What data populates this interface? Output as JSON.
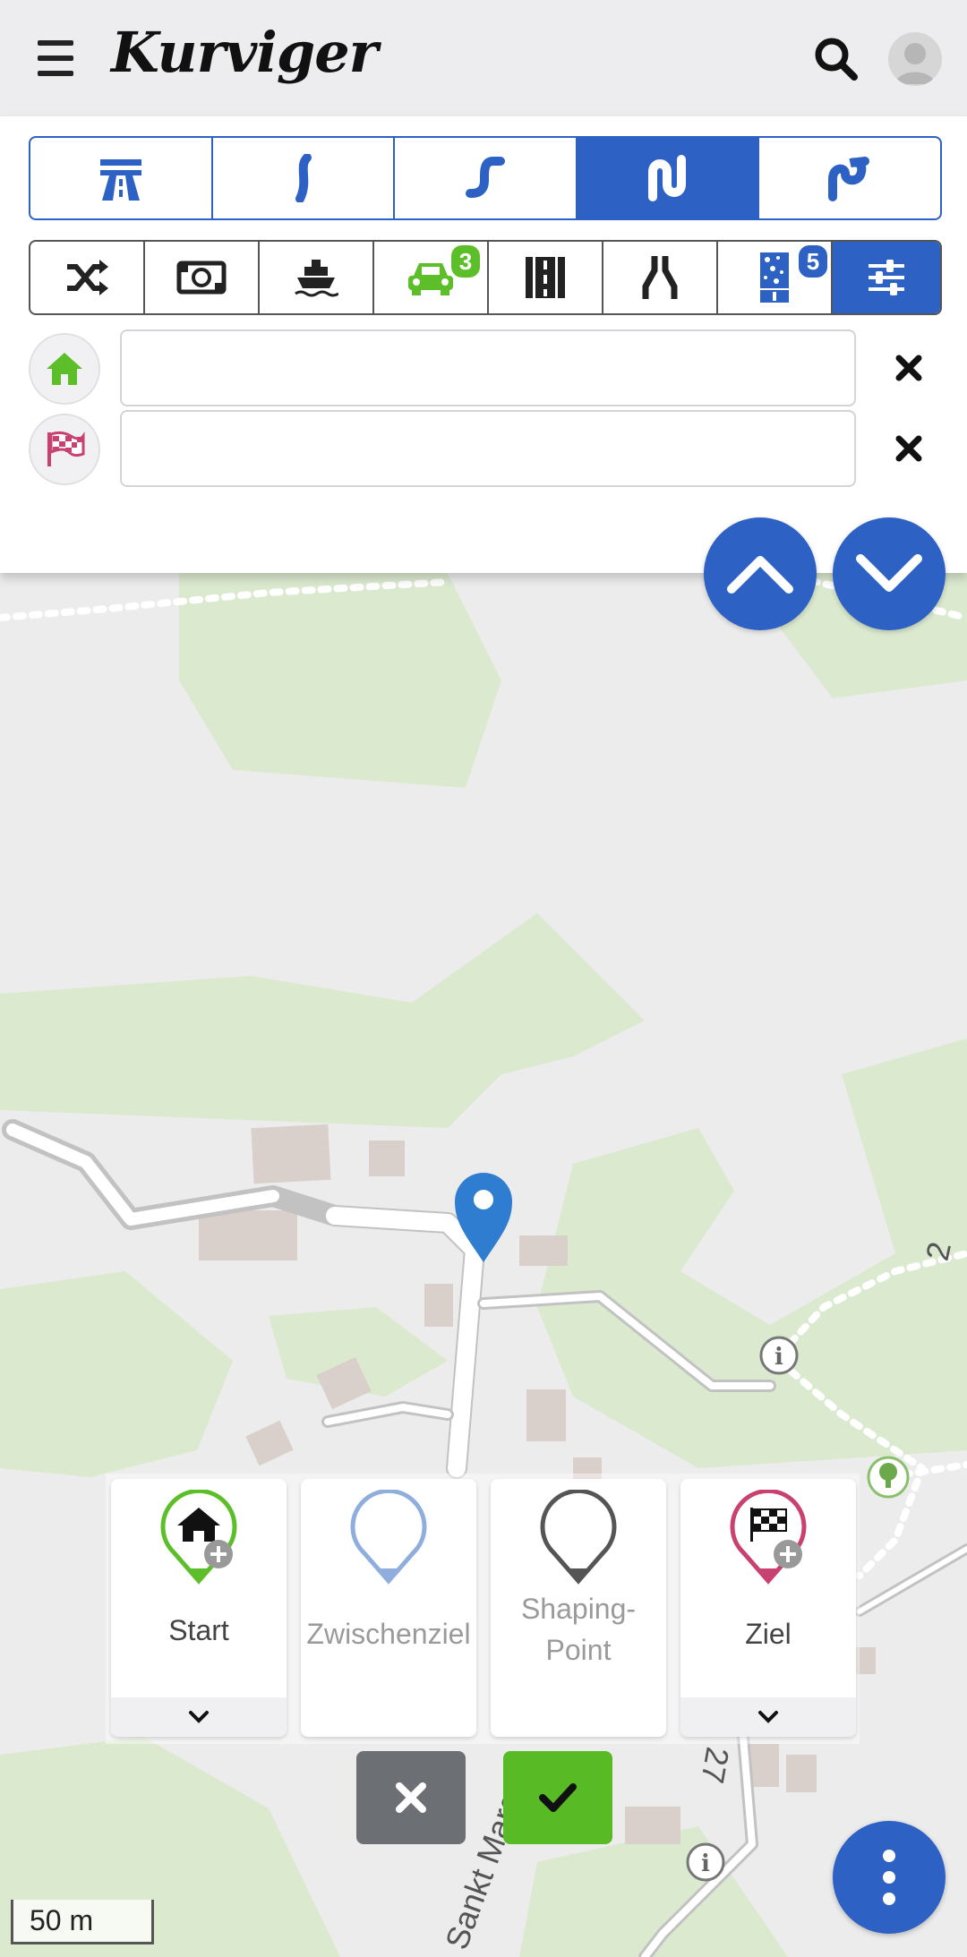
{
  "header": {
    "logo_text": "Kurviger",
    "menu_icon": "hamburger-icon",
    "search_icon": "search-icon",
    "avatar_icon": "user-avatar-icon"
  },
  "curviness_options": [
    {
      "name": "fastest",
      "icon": "highway-icon",
      "active": false
    },
    {
      "name": "curvy",
      "icon": "slight-curve-icon",
      "active": false
    },
    {
      "name": "curvier",
      "icon": "curve-icon",
      "active": false
    },
    {
      "name": "extra-curvy",
      "icon": "extra-curve-icon",
      "active": true
    },
    {
      "name": "curviest",
      "icon": "max-curve-icon",
      "active": false
    }
  ],
  "route_options": [
    {
      "name": "roundtrip",
      "icon": "shuffle-icon"
    },
    {
      "name": "toll",
      "icon": "money-icon"
    },
    {
      "name": "ferry",
      "icon": "ferry-icon"
    },
    {
      "name": "vehicle",
      "icon": "car-icon",
      "badge": "3"
    },
    {
      "name": "road-type",
      "icon": "road-icon"
    },
    {
      "name": "narrow-roads",
      "icon": "narrow-road-icon"
    },
    {
      "name": "surface",
      "icon": "surface-icon",
      "badge": "5"
    },
    {
      "name": "settings",
      "icon": "sliders-icon"
    }
  ],
  "waypoints": {
    "start": {
      "value": "",
      "placeholder": "",
      "icon": "home-icon"
    },
    "destination": {
      "value": "",
      "placeholder": "",
      "icon": "checkered-flag-icon"
    }
  },
  "map": {
    "scale_label": "50 m",
    "route_label_1": "Sankt Marg",
    "route_label_2": "27",
    "route_label_3": "2"
  },
  "waypoint_types": {
    "start": "Start",
    "via": "Zwischenziel",
    "shaping_line1": "Shaping-",
    "shaping_line2": "Point",
    "destination": "Ziel"
  },
  "colors": {
    "accent": "#2d62c4",
    "start_green": "#5cbf2a",
    "destination_pink": "#c8416f",
    "confirm_green": "#58ba24",
    "cancel_gray": "#6c6f74"
  }
}
